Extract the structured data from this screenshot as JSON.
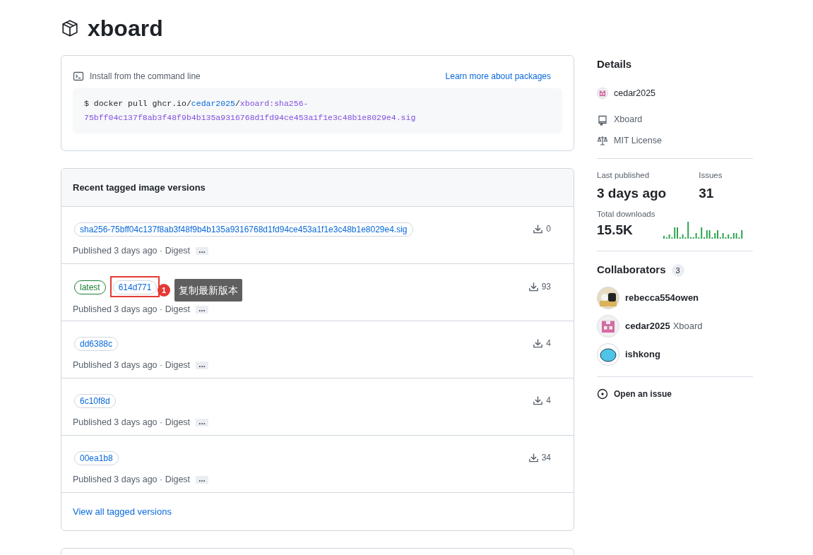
{
  "package": {
    "name": "xboard"
  },
  "install": {
    "label": "Install from the command line",
    "link": "Learn more about packages",
    "command": [
      {
        "kind": "plain",
        "text": "$ docker pull ghcr.io/"
      },
      {
        "kind": "owner",
        "text": "cedar2025"
      },
      {
        "kind": "plain",
        "text": "/"
      },
      {
        "kind": "image",
        "text": "xboard:sha256-75bff04c137f8ab3f48f9b4b135a9316768d1fd94ce453a1f1e3c48b1e8029e4.sig"
      }
    ]
  },
  "versions": {
    "title": "Recent tagged image versions",
    "rows": [
      {
        "tags": [
          {
            "text": "sha256-75bff04c137f8ab3f48f9b4b135a9316768d1fd94ce453a1f1e3c48b1e8029e4.sig",
            "kind": "digest",
            "highlighted": false
          }
        ],
        "downloads": "0",
        "published": "Published 3 days ago · Digest",
        "more": "…"
      },
      {
        "tags": [
          {
            "text": "latest",
            "kind": "latest",
            "highlighted": false
          },
          {
            "text": "614d771",
            "kind": "digest",
            "highlighted": true
          }
        ],
        "downloads": "93",
        "published": "Published 3 days ago · Digest",
        "more": "…",
        "annotation": {
          "number": "1",
          "text": "复制最新版本"
        }
      },
      {
        "tags": [
          {
            "text": "dd6388c",
            "kind": "digest",
            "highlighted": false
          }
        ],
        "downloads": "4",
        "published": "Published 3 days ago · Digest",
        "more": "…"
      },
      {
        "tags": [
          {
            "text": "6c10f8d",
            "kind": "digest",
            "highlighted": false
          }
        ],
        "downloads": "4",
        "published": "Published 3 days ago · Digest",
        "more": "…"
      },
      {
        "tags": [
          {
            "text": "00ea1b8",
            "kind": "digest",
            "highlighted": false
          }
        ],
        "downloads": "34",
        "published": "Published 3 days ago · Digest",
        "more": "…"
      }
    ],
    "view_all": "View all tagged versions"
  },
  "details": {
    "title": "Details",
    "items": [
      {
        "kind": "owner",
        "text": "cedar2025"
      },
      {
        "kind": "repo",
        "text": "Xboard"
      },
      {
        "kind": "license",
        "text": "MIT License"
      }
    ],
    "last_published_label": "Last published",
    "last_published": "3 days ago",
    "issues_label": "Issues",
    "issues": "31",
    "downloads_label": "Total downloads",
    "downloads": "15.5K"
  },
  "collaborators": {
    "title": "Collaborators",
    "count": "3",
    "people": [
      {
        "name": "rebecca554owen",
        "kind": "photo"
      },
      {
        "name": "cedar2025",
        "note": "Xboard",
        "kind": "identicon"
      },
      {
        "name": "ishkong",
        "kind": "cartoon"
      }
    ]
  },
  "open_issue": "Open an issue"
}
